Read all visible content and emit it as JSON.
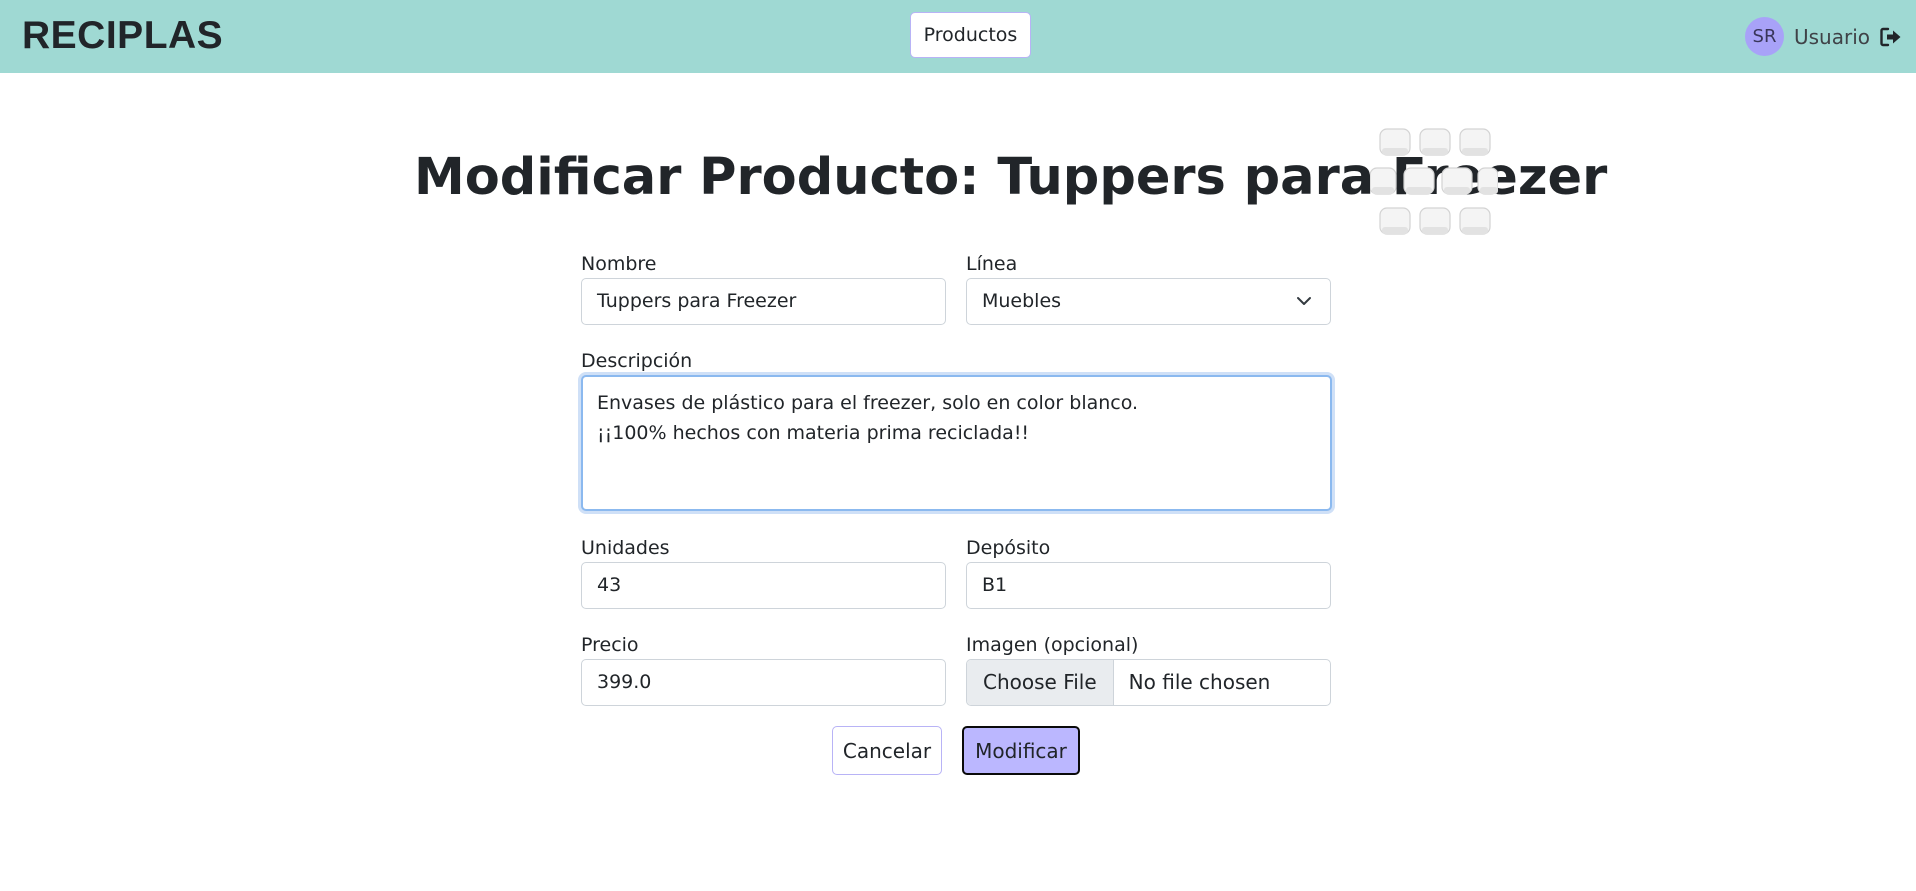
{
  "navbar": {
    "brand": "RECIPLAS",
    "productos_label": "Productos",
    "avatar_initials": "SR",
    "user_label": "Usuario"
  },
  "page": {
    "title": "Modificar Producto: Tuppers para Freezer"
  },
  "form": {
    "nombre": {
      "label": "Nombre",
      "value": "Tuppers para Freezer"
    },
    "linea": {
      "label": "Línea",
      "value": "Muebles"
    },
    "descripcion": {
      "label": "Descripción",
      "value": "Envases de plástico para el freezer, solo en color blanco.\n¡¡100% hechos con materia prima reciclada!!"
    },
    "unidades": {
      "label": "Unidades",
      "value": "43"
    },
    "deposito": {
      "label": "Depósito",
      "value": "B1"
    },
    "precio": {
      "label": "Precio",
      "value": "399.0"
    },
    "imagen": {
      "label": "Imagen (opcional)",
      "button": "Choose File",
      "status": "No file chosen"
    },
    "cancel_label": "Cancelar",
    "submit_label": "Modificar"
  },
  "colors": {
    "navbar_bg": "#9fd9d3",
    "accent": "#bbb7ff",
    "avatar_bg": "#a8a2f8"
  },
  "icons": {
    "logout": "logout-icon",
    "chevron": "chevron-down-icon"
  }
}
